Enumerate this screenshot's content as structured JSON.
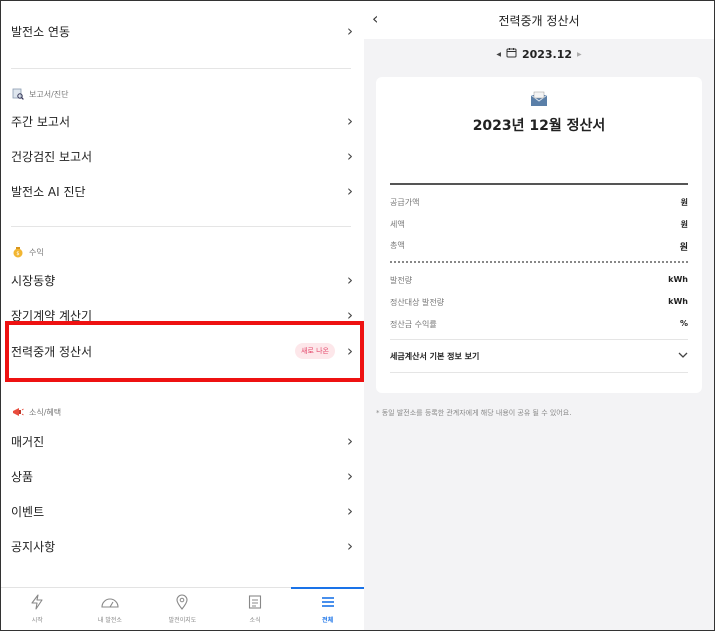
{
  "menu": {
    "top_item": "발전소 연동",
    "sections": {
      "report": {
        "title": "보고서/진단",
        "items": [
          "주간 보고서",
          "건강검진 보고서",
          "발전소 AI 진단"
        ]
      },
      "revenue": {
        "title": "수익",
        "items": [
          "시장동향",
          "장기계약 계산기",
          "전력중개 정산서"
        ],
        "new_badge": "새로 나온"
      },
      "news": {
        "title": "소식/혜택",
        "items": [
          "매거진",
          "상품",
          "이벤트",
          "공지사항"
        ]
      }
    }
  },
  "tabbar": [
    {
      "label": "시작",
      "icon": "lightning-icon"
    },
    {
      "label": "내 발전소",
      "icon": "gauge-icon"
    },
    {
      "label": "발전이지도",
      "icon": "map-pin-icon"
    },
    {
      "label": "소식",
      "icon": "news-icon"
    },
    {
      "label": "전체",
      "icon": "menu-icon",
      "active": true
    }
  ],
  "detail": {
    "header_title": "전력중개 정산서",
    "month": "2023.12",
    "card_title": "2023년 12월 정산서",
    "amounts": [
      {
        "label": "공급가액",
        "value": "원"
      },
      {
        "label": "세액",
        "value": "원"
      },
      {
        "label": "총액",
        "value": "원"
      }
    ],
    "generation": [
      {
        "label": "발전량",
        "value": "kWh"
      },
      {
        "label": "정산대상 발전량",
        "value": "kWh"
      },
      {
        "label": "정산금 수익률",
        "value": "%"
      }
    ],
    "tax_invoice_label": "세금계산서 기본 정보 보기",
    "footnote": "* 동일 발전소를 등록한 관계자에게 해당 내용이 공유 될 수 있어요."
  },
  "colors": {
    "accent": "#1a73e8",
    "highlight": "#ee1111",
    "badge_bg": "#fde7ea",
    "badge_text": "#e3476b"
  }
}
